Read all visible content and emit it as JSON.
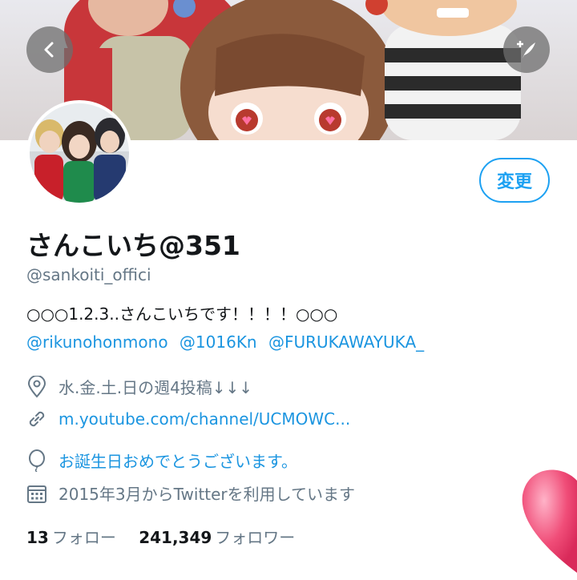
{
  "header": {
    "edit_button_label": "変更"
  },
  "profile": {
    "display_name": "さんこいち@351",
    "handle": "@sankoiti_offici",
    "bio": "○○○1.2.3..さんこいちです！！！！○○○",
    "mentions": [
      "@rikunohonmono",
      "@1016Kn",
      "@FURUKAWAYUKA_"
    ],
    "location": "水.金.土.日の週4投稿↓↓↓",
    "website": "m.youtube.com/channel/UCMOWC...",
    "birthday": "お誕生日おめでとうございます。",
    "joined": "2015年3月からTwitterを利用しています"
  },
  "stats": {
    "following_count": "13",
    "following_label": "フォロー",
    "followers_count": "241,349",
    "followers_label": "フォロワー"
  },
  "colors": {
    "accent": "#1b95e0",
    "button_border": "#1da1f2",
    "text": "#14171a",
    "muted": "#657786"
  },
  "icons": [
    "back-arrow-icon",
    "compose-icon",
    "location-icon",
    "link-icon",
    "balloon-icon",
    "calendar-icon",
    "heart-icon"
  ]
}
